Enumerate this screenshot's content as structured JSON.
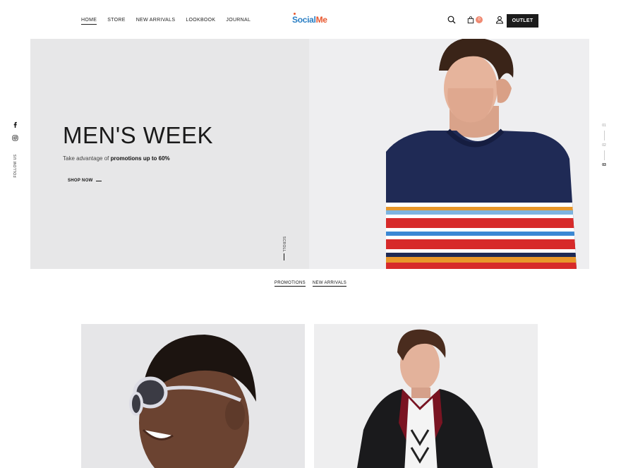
{
  "header": {
    "nav": [
      {
        "label": "HOME",
        "active": true
      },
      {
        "label": "STORE",
        "active": false
      },
      {
        "label": "NEW ARRIVALS",
        "active": false
      },
      {
        "label": "LOOKBOOK",
        "active": false
      },
      {
        "label": "JOURNAL",
        "active": false
      }
    ],
    "logo": {
      "part1": "Social",
      "part2": "Me",
      "colors": {
        "part1": "#2b7fc4",
        "part2": "#e8572e"
      }
    },
    "icons": [
      "search-icon",
      "cart-icon",
      "user-icon"
    ],
    "cart_count": "0",
    "outlet_label": "OUTLET"
  },
  "social": {
    "icons": [
      "facebook-icon",
      "instagram-icon"
    ],
    "follow_label": "FOLLOW US"
  },
  "pager": {
    "items": [
      "01",
      "02",
      "03"
    ],
    "active_index": 2
  },
  "hero": {
    "title": "MEN'S WEEK",
    "subtitle_prefix": "Take advantage of",
    "subtitle_bold": "promotions up to 60%",
    "cta_label": "SHOP NOW",
    "scroll_label": "SCROLL"
  },
  "tabs": [
    {
      "label": "PROMOTIONS"
    },
    {
      "label": "NEW ARRIVALS"
    }
  ],
  "colors": {
    "dark": "#1c1c1c",
    "accent": "#f08a72",
    "hero_bg": "#e7e7e8"
  }
}
